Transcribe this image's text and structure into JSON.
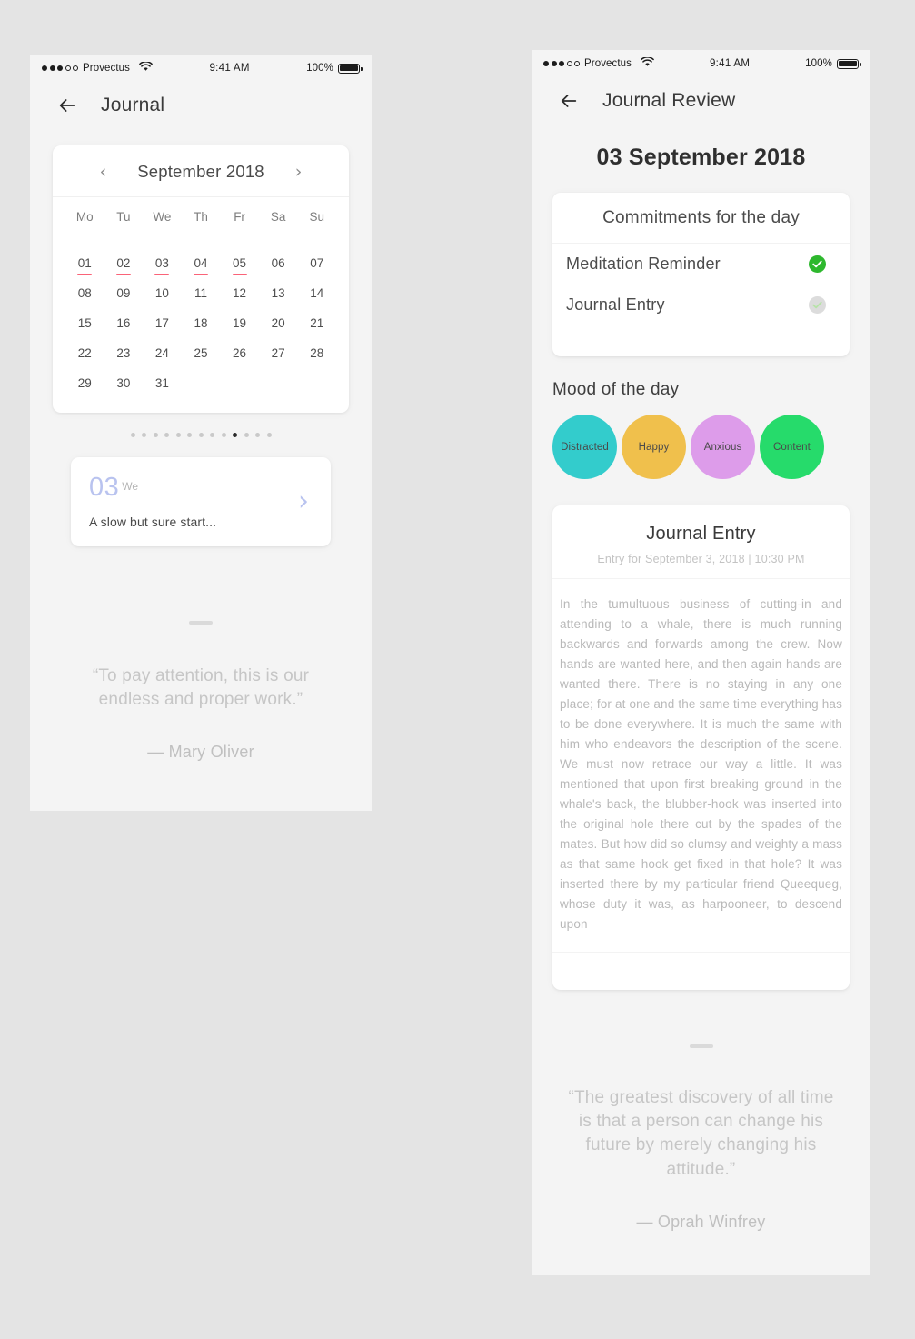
{
  "status_bar": {
    "carrier": "Provectus",
    "time": "9:41 AM",
    "battery_percent": "100%",
    "signal_filled": 3,
    "signal_hollow": 2
  },
  "left_screen": {
    "nav": {
      "title": "Journal",
      "back_icon": "arrow-left-icon"
    },
    "calendar": {
      "month_title": "September 2018",
      "prev_icon": "chevron-left-icon",
      "next_icon": "chevron-right-icon",
      "day_headers": [
        "Mo",
        "Tu",
        "We",
        "Th",
        "Fr",
        "Sa",
        "Su"
      ],
      "days": [
        "01",
        "02",
        "03",
        "04",
        "05",
        "06",
        "07",
        "08",
        "09",
        "10",
        "11",
        "12",
        "13",
        "14",
        "15",
        "16",
        "17",
        "18",
        "19",
        "20",
        "21",
        "22",
        "23",
        "24",
        "25",
        "26",
        "27",
        "28",
        "29",
        "30",
        "31"
      ],
      "marked_days": [
        "01",
        "02",
        "03",
        "04",
        "05"
      ],
      "marker_color": "#fa6378"
    },
    "pager": {
      "total": 13,
      "active_index": 9
    },
    "entry_preview": {
      "day_number": "03",
      "day_of_week": "We",
      "snippet": "A slow but sure start...",
      "chevron_icon": "chevron-right-icon",
      "accent_color": "#b9c3ef"
    },
    "quote": {
      "text": "“To pay attention, this is our endless and proper work.”",
      "author": "— Mary Oliver"
    }
  },
  "right_screen": {
    "nav": {
      "title": "Journal Review",
      "back_icon": "arrow-left-icon"
    },
    "date_title": "03 September 2018",
    "commitments": {
      "header": "Commitments for the day",
      "items": [
        {
          "label": "Meditation Reminder",
          "status": "done"
        },
        {
          "label": "Journal Entry",
          "status": "pending"
        }
      ],
      "done_color": "#2eb82e",
      "pending_color": "#dcdcdc"
    },
    "mood": {
      "section_title": "Mood of the day",
      "options": [
        {
          "label": "Distracted",
          "color": "#33cccc"
        },
        {
          "label": "Happy",
          "color": "#f0c04c"
        },
        {
          "label": "Anxious",
          "color": "#dd9cea"
        },
        {
          "label": "Content",
          "color": "#26db6b"
        }
      ]
    },
    "journal": {
      "title": "Journal Entry",
      "subtitle": "Entry for September 3, 2018 | 10:30 PM",
      "body": "In the tumultuous business of cutting-in and attending to a whale, there is much running backwards and forwards among the crew. Now hands are wanted here, and then again hands are wanted there. There is no staying in any one place; for at one and the same time everything has to be done everywhere. It is much the same with him who endeavors the description of the scene. We must now retrace our way a little. It was mentioned that upon first breaking ground in the whale's back, the blubber-hook was inserted into the original hole there cut by the spades of the mates. But how did so clumsy and weighty a mass as that same hook get fixed in that hole? It was inserted there by my particular friend Queequeg, whose duty it was, as harpooneer, to descend upon"
    },
    "quote": {
      "text": "“The greatest discovery of all time is that a person can change his future by merely changing his attitude.”",
      "author": "— Oprah Winfrey"
    }
  }
}
